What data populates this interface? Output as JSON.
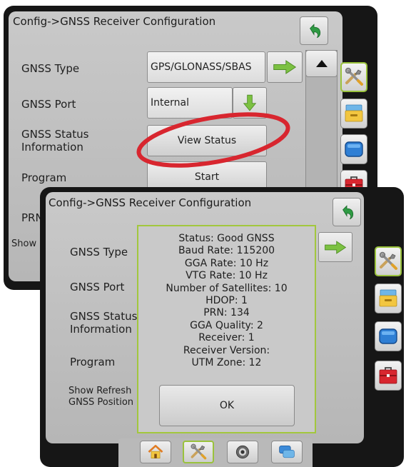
{
  "back_screen": {
    "title": "Config->GNSS Receiver Configuration",
    "rows": [
      {
        "label": "GNSS Type",
        "value": "GPS/GLONASS/SBAS"
      },
      {
        "label": "GNSS Port",
        "value": "Internal"
      },
      {
        "label": "GNSS Status Information",
        "value": "View Status"
      },
      {
        "label": "Program",
        "value": "Start"
      },
      {
        "label": "PRN",
        "value": ""
      },
      {
        "label": "Show Refresh GNSS Position",
        "value": ""
      }
    ],
    "highlight_color": "#d8262f"
  },
  "front_screen": {
    "title": "Config->GNSS Receiver Configuration",
    "labels": {
      "gnss_type": "GNSS Type",
      "gnss_port": "GNSS Port",
      "gnss_status": "GNSS Status Information",
      "program": "Program",
      "show_refresh": "Show Refresh GNSS Position"
    }
  },
  "status_dialog": {
    "lines": [
      "Status: Good GNSS",
      "Baud Rate: 115200",
      "GGA Rate: 10 Hz",
      "VTG Rate: 10 Hz",
      "Number of Satellites: 10",
      "HDOP: 1",
      "PRN: 134",
      "GGA Quality: 2",
      "Receiver: 1",
      "Receiver Version:",
      "UTM Zone: 12"
    ],
    "ok_label": "OK",
    "border_color": "#a2c73d"
  },
  "icons": {
    "back": "back-arrow-icon",
    "next": "right-arrow-icon",
    "dropdown": "down-arrow-icon",
    "scroll_up": "up-triangle-icon",
    "tools": "tools-icon",
    "drawer": "drawer-icon",
    "screen": "blue-screen-icon",
    "toolbox": "toolbox-icon",
    "home": "home-icon",
    "camera": "camera-icon",
    "chat": "chat-icon"
  }
}
